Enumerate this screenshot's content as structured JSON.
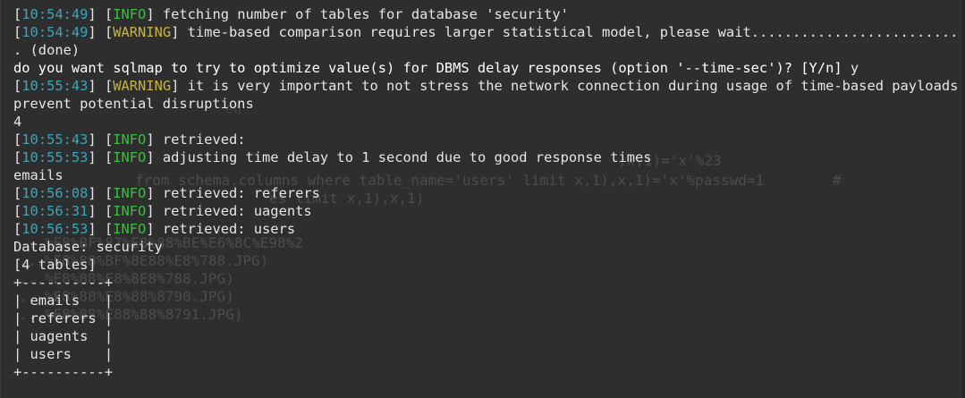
{
  "lines": [
    {
      "parts": [
        [
          "plain",
          "["
        ],
        [
          "time",
          "10:54:49"
        ],
        [
          "plain",
          "] ["
        ],
        [
          "info",
          "INFO"
        ],
        [
          "plain",
          "] fetching number of tables for database 'security'"
        ]
      ]
    },
    {
      "parts": [
        [
          "plain",
          "["
        ],
        [
          "time",
          "10:54:49"
        ],
        [
          "plain",
          "] ["
        ],
        [
          "warn",
          "WARNING"
        ],
        [
          "plain",
          "] time-based comparison requires larger statistical model, please wait............................."
        ]
      ]
    },
    {
      "parts": [
        [
          "plain",
          ". (done)"
        ]
      ]
    },
    {
      "parts": [
        [
          "bold",
          "do you want sqlmap to try to optimize value(s) for DBMS delay responses (option '--time-sec')? [Y/n] "
        ],
        [
          "plain",
          "y"
        ]
      ]
    },
    {
      "parts": [
        [
          "plain",
          "["
        ],
        [
          "time",
          "10:55:43"
        ],
        [
          "plain",
          "] ["
        ],
        [
          "warn",
          "WARNING"
        ],
        [
          "plain",
          "] it is very important to not stress the network connection during usage of time-based payloads to"
        ]
      ]
    },
    {
      "parts": [
        [
          "plain",
          "prevent potential disruptions"
        ]
      ]
    },
    {
      "parts": [
        [
          "plain",
          "4"
        ]
      ]
    },
    {
      "parts": [
        [
          "plain",
          "["
        ],
        [
          "time",
          "10:55:43"
        ],
        [
          "plain",
          "] ["
        ],
        [
          "info",
          "INFO"
        ],
        [
          "plain",
          "] retrieved:"
        ]
      ]
    },
    {
      "parts": [
        [
          "plain",
          "["
        ],
        [
          "time",
          "10:55:53"
        ],
        [
          "plain",
          "] ["
        ],
        [
          "info",
          "INFO"
        ],
        [
          "plain",
          "] adjusting time delay to 1 second due to good response times"
        ]
      ]
    },
    {
      "parts": [
        [
          "plain",
          "emails"
        ]
      ]
    },
    {
      "parts": [
        [
          "plain",
          "["
        ],
        [
          "time",
          "10:56:08"
        ],
        [
          "plain",
          "] ["
        ],
        [
          "info",
          "INFO"
        ],
        [
          "plain",
          "] retrieved: referers"
        ]
      ]
    },
    {
      "parts": [
        [
          "plain",
          "["
        ],
        [
          "time",
          "10:56:31"
        ],
        [
          "plain",
          "] ["
        ],
        [
          "info",
          "INFO"
        ],
        [
          "plain",
          "] retrieved: uagents"
        ]
      ]
    },
    {
      "parts": [
        [
          "plain",
          "["
        ],
        [
          "time",
          "10:56:53"
        ],
        [
          "plain",
          "] ["
        ],
        [
          "info",
          "INFO"
        ],
        [
          "plain",
          "] retrieved: users"
        ]
      ]
    },
    {
      "parts": [
        [
          "plain",
          "Database: security"
        ]
      ]
    },
    {
      "parts": [
        [
          "plain",
          "[4 tables]"
        ]
      ]
    },
    {
      "parts": [
        [
          "plain",
          "+----------+"
        ]
      ]
    },
    {
      "parts": [
        [
          "plain",
          "| emails   |"
        ]
      ]
    },
    {
      "parts": [
        [
          "plain",
          "| referers |"
        ]
      ]
    },
    {
      "parts": [
        [
          "plain",
          "| uagents  |"
        ]
      ]
    },
    {
      "parts": [
        [
          "plain",
          "| users    |"
        ]
      ]
    },
    {
      "parts": [
        [
          "plain",
          "+----------+"
        ]
      ]
    }
  ],
  "colors": {
    "background": "#2e2e2e",
    "timestamp": "#3fa3b8",
    "info": "#36c23a",
    "warning": "#c7b43a",
    "text": "#e6e6e6"
  }
}
